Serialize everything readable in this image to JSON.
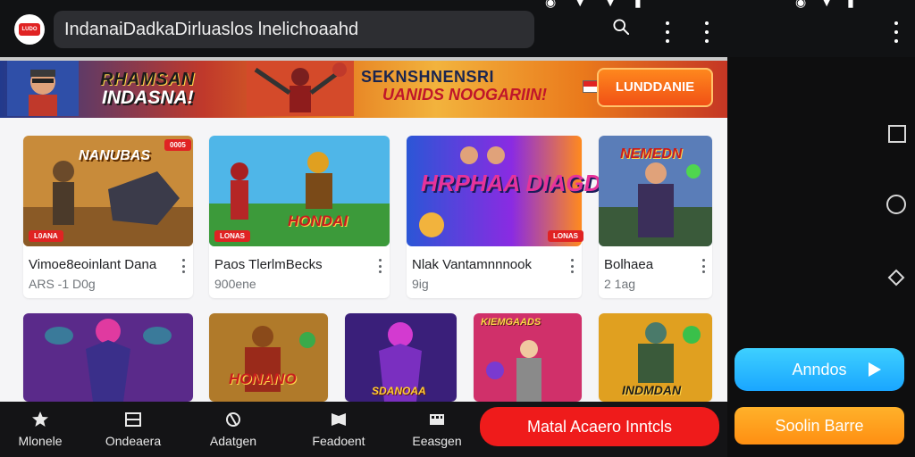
{
  "header": {
    "app_logo_label": "LUDO",
    "search_text": "IndanaiDadkaDirluaslos lnelichoaahd"
  },
  "banner": {
    "title_line1": "RHAMSAN",
    "title_line2": "INDASNA!",
    "headline": "SEKNSHNENSRI",
    "subheadline": "UANIDS NOOGARIIN!",
    "cta_label": "LUNDDANIE"
  },
  "games": [
    {
      "title": "Vimoe8eoinlant Dana",
      "meta": "ARS -1 D0g",
      "badge_top": "0005",
      "badge_bottom": "L0ANA",
      "thumb_text": "NANUBAS"
    },
    {
      "title": "Paos TlerlmBecks",
      "meta": "900ene",
      "badge_bottom": "LONAS",
      "thumb_text": "HONDAI"
    },
    {
      "title": "Nlak Vantamnnnook",
      "meta": "9ig",
      "badge_bottom": "LONAS",
      "thumb_text": "HRPHAA DIAGD"
    },
    {
      "title": "Bolhaea",
      "meta": "2 1ag",
      "thumb_text": "NEMEDN"
    },
    {
      "title": "",
      "meta": "",
      "thumb_text": ""
    },
    {
      "title": "",
      "meta": "",
      "thumb_text": "HONANO"
    },
    {
      "title": "",
      "meta": "",
      "thumb_text": "SDANOAA"
    },
    {
      "title": "",
      "meta": "",
      "thumb_text": "KIEMGAADS"
    },
    {
      "title": "",
      "meta": "",
      "thumb_text": "INDMDAN"
    }
  ],
  "bottom_nav": [
    {
      "label": "Mlonele",
      "icon": "star-icon"
    },
    {
      "label": "Ondeaera",
      "icon": "grid-icon"
    },
    {
      "label": "Adatgen",
      "icon": "gamepad-icon"
    },
    {
      "label": "Feadoent",
      "icon": "book-icon"
    },
    {
      "label": "Eeasgen",
      "icon": "apps-icon"
    }
  ],
  "actions": {
    "red_pill": "Matal Acaero Inntcls",
    "blue_pill": "Anndos",
    "orange_pill": "Soolin Barre"
  },
  "colors": {
    "accent_red": "#ef1b1b",
    "accent_blue": "#1aa6ff",
    "accent_orange": "#ff8f12",
    "background": "#0e0e0f"
  }
}
